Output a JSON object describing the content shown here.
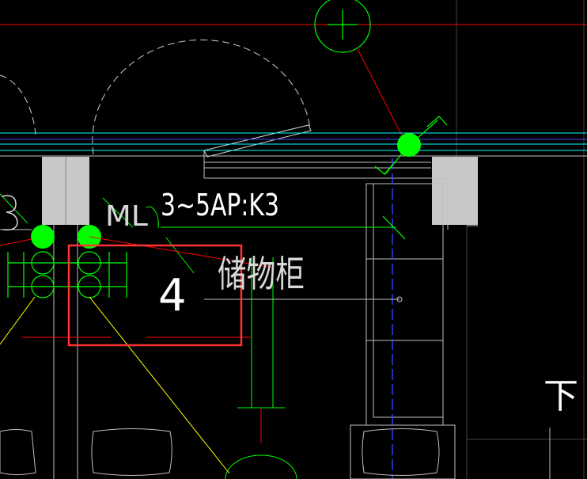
{
  "annotations": {
    "label_circuit": "3~5AP:K3",
    "label_room": "储物柜",
    "label_number": "4",
    "label_ml": "ML",
    "label_down": "下"
  },
  "colors": {
    "background": "#000000",
    "gridline": "#ff0000",
    "wall_gray": "#c8c8c8",
    "wall_line": "#bfbfbf",
    "pipe_cyan": "#00ffff",
    "pipe_blue": "#0000ff",
    "fixture_green": "#00ff00",
    "leader_yellow": "#ffff00",
    "text_white": "#ffffff",
    "selection_box": "#ff3333"
  }
}
